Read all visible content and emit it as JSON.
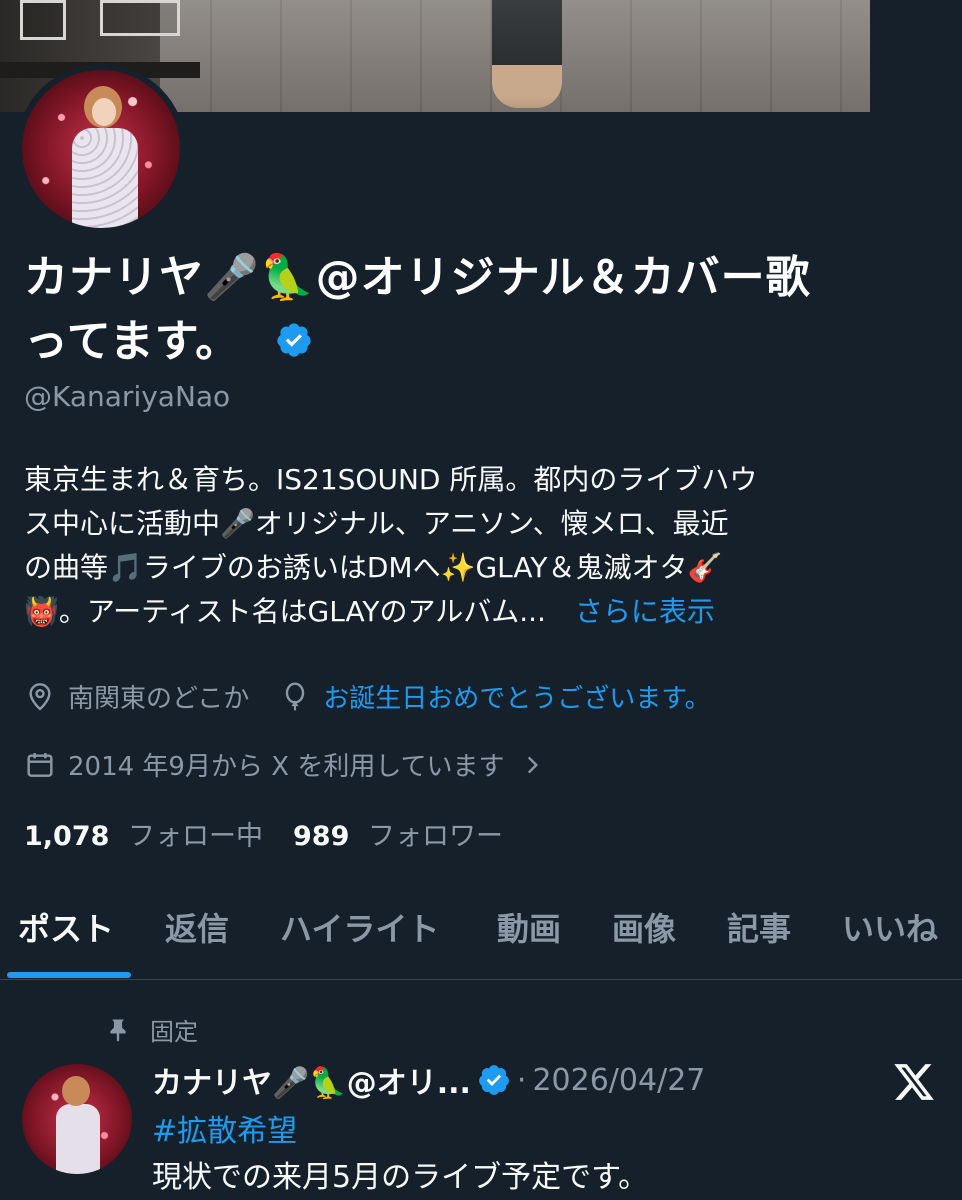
{
  "profile": {
    "name_line1": "カナリヤ🎤🦜@オリジナル＆カバー歌",
    "name_line2": "ってます。",
    "handle": "@KanariyaNao",
    "bio_lines": [
      "東京生まれ＆育ち。IS21SOUND 所属。都内のライブハウ",
      "ス中心に活動中🎤オリジナル、アニソン、懐メロ、最近",
      "の曲等🎵ライブのお誘いはDMへ✨GLAY＆鬼滅オタ🎸",
      "👹。アーティスト名はGLAYのアルバム..."
    ],
    "show_more": "さらに表示",
    "location": "南関東のどこか",
    "birthday": "お誕生日おめでとうございます。",
    "joined": "2014 年9月から X を利用しています",
    "following_count": "1,078",
    "following_label": "フォロー中",
    "followers_count": "989",
    "followers_label": "フォロワー"
  },
  "tabs": [
    "ポスト",
    "返信",
    "ハイライト",
    "動画",
    "画像",
    "記事",
    "いいね"
  ],
  "active_tab": "ポスト",
  "post": {
    "pinned_label": "固定",
    "author": "カナリヤ🎤🦜@オリ...",
    "separator": "·",
    "date": "2026/04/27",
    "hashtag": "#拡散希望",
    "text": "現状での来月5月のライブ予定です。"
  },
  "colors": {
    "background": "#15202b",
    "accent": "#1d9bf0",
    "secondary_text": "#8b98a5"
  },
  "icons": [
    "location-icon",
    "balloon-icon",
    "calendar-icon",
    "chevron-right-icon",
    "verified-badge-icon",
    "pin-icon",
    "x-logo-icon"
  ]
}
